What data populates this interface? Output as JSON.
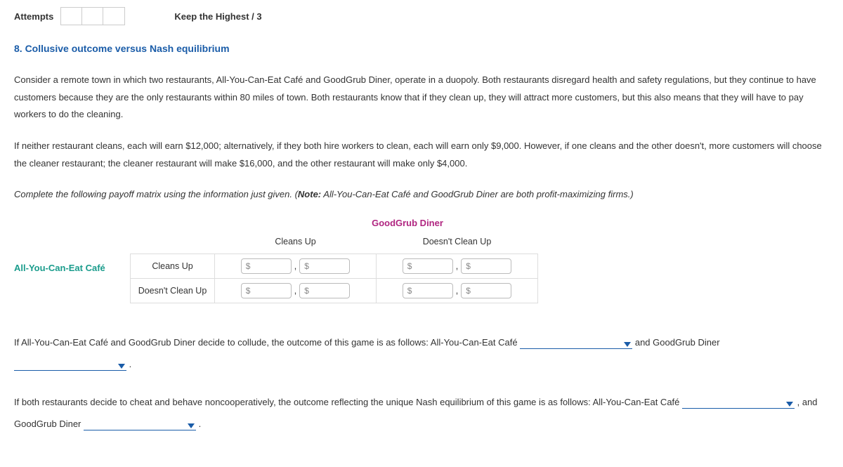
{
  "top": {
    "attempts_label": "Attempts",
    "keep_highest": "Keep the Highest / 3"
  },
  "title": "8. Collusive outcome versus Nash equilibrium",
  "para1": "Consider a remote town in which two restaurants, All-You-Can-Eat Café and GoodGrub Diner, operate in a duopoly. Both restaurants disregard health and safety regulations, but they continue to have customers because they are the only restaurants within 80 miles of town. Both restaurants know that if they clean up, they will attract more customers, but this also means that they will have to pay workers to do the cleaning.",
  "para2": "If neither restaurant cleans, each will earn $12,000; alternatively, if they both hire workers to clean, each will earn only $9,000. However, if one cleans and the other doesn't, more customers will choose the cleaner restaurant; the cleaner restaurant will make $16,000, and the other restaurant will make only $4,000.",
  "instr_pre": "Complete the following payoff matrix using the information just given. (",
  "instr_note_label": "Note:",
  "instr_note_text": " All-You-Can-Eat Café and GoodGrub Diner are both profit-maximizing firms.)",
  "matrix": {
    "col_player": "GoodGrub Diner",
    "row_player": "All-You-Can-Eat Café",
    "col_headers": [
      "Cleans Up",
      "Doesn't Clean Up"
    ],
    "row_headers": [
      "Cleans Up",
      "Doesn't Clean Up"
    ],
    "placeholder": "$"
  },
  "q1": {
    "t1": "If All-You-Can-Eat Café and GoodGrub Diner decide to collude, the outcome of this game is as follows: All-You-Can-Eat Café ",
    "t2": " and GoodGrub Diner ",
    "t3": " ."
  },
  "q2": {
    "t1": "If both restaurants decide to cheat and behave noncooperatively, the outcome reflecting the unique Nash equilibrium of this game is as follows: All-You-Can-Eat Café ",
    "t2": " , and GoodGrub Diner ",
    "t3": " ."
  }
}
